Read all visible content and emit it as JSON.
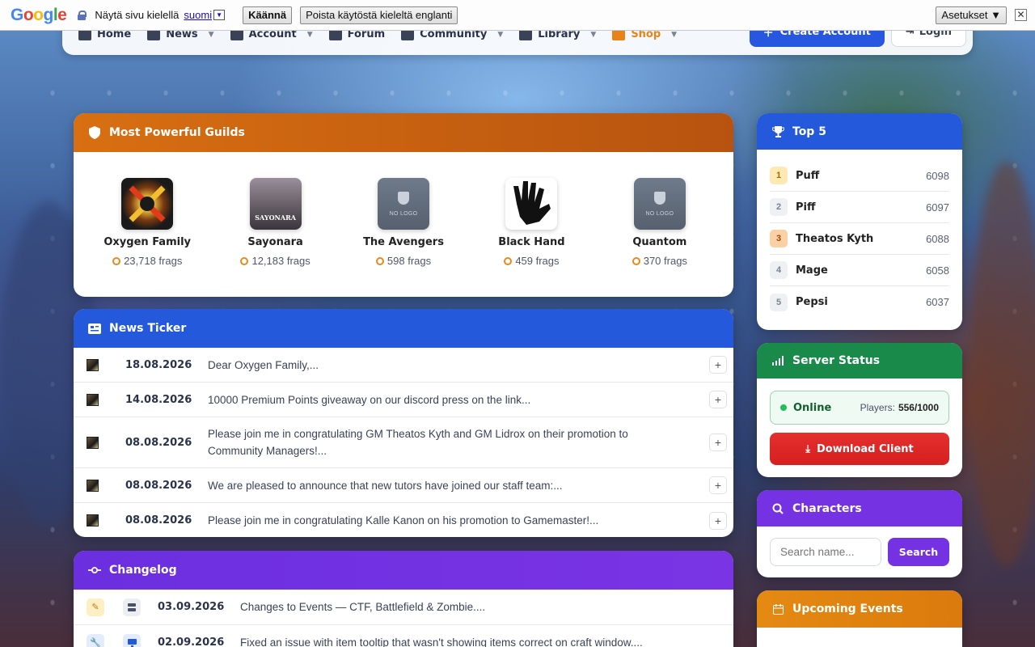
{
  "translate_bar": {
    "prompt": "Näytä sivu kielellä",
    "language": "suomi",
    "translate_button": "Käännä",
    "disable_button": "Poista käytöstä kieleltä englanti",
    "settings_button": "Asetukset ▼",
    "close": "✕"
  },
  "nav": {
    "items": [
      {
        "label": "Home",
        "icon": "home-icon"
      },
      {
        "label": "News",
        "icon": "newspaper-icon"
      },
      {
        "label": "Account",
        "icon": "user-cog-icon"
      },
      {
        "label": "Forum",
        "icon": "chat-icon"
      },
      {
        "label": "Community",
        "icon": "users-icon"
      },
      {
        "label": "Library",
        "icon": "book-icon"
      },
      {
        "label": "Shop",
        "icon": "cart-icon"
      }
    ],
    "create_account": "Create Account",
    "login": "Login"
  },
  "guilds": {
    "title": "Most Powerful Guilds",
    "items": [
      {
        "name": "Oxygen Family",
        "frags": "23,718 frags"
      },
      {
        "name": "Sayonara",
        "frags": "12,183 frags",
        "logo_text": "SAYONARA"
      },
      {
        "name": "The Avengers",
        "frags": "598 frags",
        "no_logo": "NO LOGO"
      },
      {
        "name": "Black Hand",
        "frags": "459 frags"
      },
      {
        "name": "Quantom",
        "frags": "370 frags",
        "no_logo": "NO LOGO"
      }
    ]
  },
  "news": {
    "title": "News Ticker",
    "rows": [
      {
        "date": "18.08.2026",
        "text": "Dear Oxygen Family,..."
      },
      {
        "date": "14.08.2026",
        "text": "10000 Premium Points giveaway on our discord press on the link..."
      },
      {
        "date": "08.08.2026",
        "text": "Please join me in congratulating GM Theatos Kyth and GM Lidrox on their promotion to Community Managers!..."
      },
      {
        "date": "08.08.2026",
        "text": "We are pleased to announce that new tutors have joined our staff team:..."
      },
      {
        "date": "08.08.2026",
        "text": "Please join me in congratulating Kalle Kanon on his promotion to Gamemaster!..."
      }
    ]
  },
  "changelog": {
    "title": "Changelog",
    "rows": [
      {
        "date": "03.09.2026",
        "text": "Changes to Events — CTF, Battlefield & Zombie...."
      },
      {
        "date": "02.09.2026",
        "text": "Fixed an issue with item tooltip that wasn't showing items correct on craft window...."
      }
    ]
  },
  "top5": {
    "title": "Top 5",
    "rows": [
      {
        "rank": "1",
        "name": "Puff",
        "score": "6098"
      },
      {
        "rank": "2",
        "name": "Piff",
        "score": "6097"
      },
      {
        "rank": "3",
        "name": "Theatos Kyth",
        "score": "6088"
      },
      {
        "rank": "4",
        "name": "Mage",
        "score": "6058"
      },
      {
        "rank": "5",
        "name": "Pepsi",
        "score": "6037"
      }
    ]
  },
  "server": {
    "title": "Server Status",
    "status": "Online",
    "players_label": "Players:",
    "players_value": "556/1000",
    "download": "Download Client"
  },
  "characters": {
    "title": "Characters",
    "placeholder": "Search name...",
    "search": "Search"
  },
  "events": {
    "title": "Upcoming Events"
  },
  "colors": {
    "guilds_header": "#d86f12",
    "news_header": "#2459db",
    "changelog_header": "#7432e2",
    "server_header": "#1a8a4a",
    "download_button": "#e02626",
    "events_header": "#e48a12"
  }
}
